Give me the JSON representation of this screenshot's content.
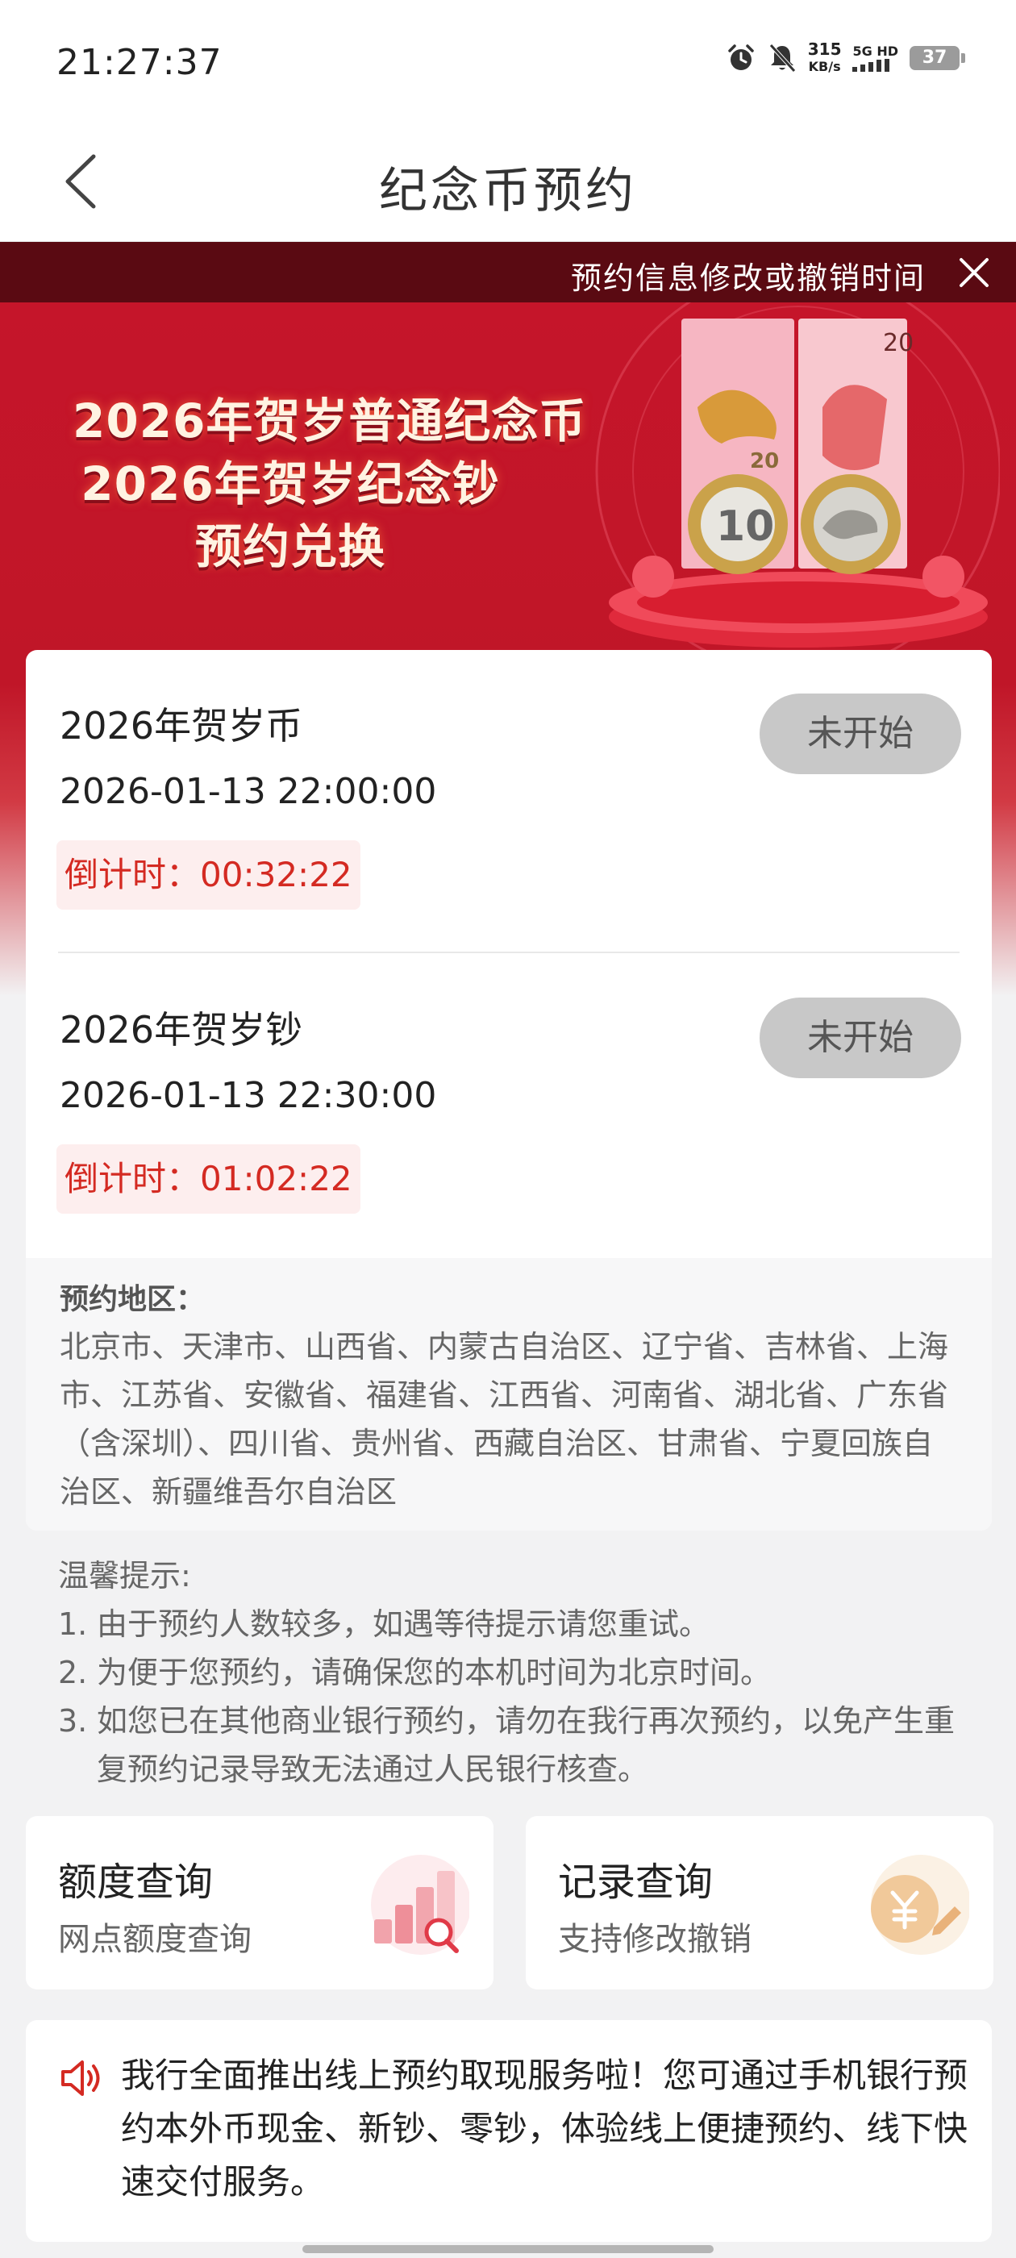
{
  "status_bar": {
    "time": "21:27:37",
    "speed_value": "315",
    "speed_unit": "KB/s",
    "network": "5G HD",
    "battery": "37"
  },
  "nav": {
    "title": "纪念币预约"
  },
  "notice": {
    "text": "预约信息修改或撤销时间"
  },
  "banner": {
    "line1": "2026年贺岁普通纪念币",
    "line2": "2026年贺岁纪念钞",
    "line3": "预约兑换",
    "note_value": "20",
    "coin_value": "10"
  },
  "items": [
    {
      "title": "2026年贺岁币",
      "time": "2026-01-13 22:00:00",
      "countdown": "倒计时：00:32:22",
      "status": "未开始"
    },
    {
      "title": "2026年贺岁钞",
      "time": "2026-01-13 22:30:00",
      "countdown": "倒计时：01:02:22",
      "status": "未开始"
    }
  ],
  "region": {
    "title": "预约地区：",
    "body": "北京市、天津市、山西省、内蒙古自治区、辽宁省、吉林省、上海市、江苏省、安徽省、福建省、江西省、河南省、湖北省、广东省（含深圳）、四川省、贵州省、西藏自治区、甘肃省、宁夏回族自治区、新疆维吾尔自治区"
  },
  "tips": {
    "title": "温馨提示:",
    "items": [
      {
        "num": "1.",
        "text": "由于预约人数较多，如遇等待提示请您重试。"
      },
      {
        "num": "2.",
        "text": "为便于您预约，请确保您的本机时间为北京时间。"
      },
      {
        "num": "3.",
        "text": "如您已在其他商业银行预约，请勿在我行再次预约，以免产生重复预约记录导致无法通过人民银行核查。"
      }
    ]
  },
  "quick": {
    "quota": {
      "title": "额度查询",
      "subtitle": "网点额度查询",
      "icon": "bar-chart-search-icon"
    },
    "record": {
      "title": "记录查询",
      "subtitle": "支持修改撤销",
      "icon": "yuan-coin-edit-icon"
    }
  },
  "announcement": {
    "icon": "speaker-icon",
    "text": "我行全面推出线上预约取现服务啦！您可通过手机银行预约本外币现金、新钞、零钞，体验线上便捷预约、线下快速交付服务。"
  },
  "colors": {
    "brand_red": "#c5152a",
    "countdown_red": "#d42a22",
    "notice_bg": "#5a0a12",
    "button_disabled": "#c8c8c8"
  }
}
